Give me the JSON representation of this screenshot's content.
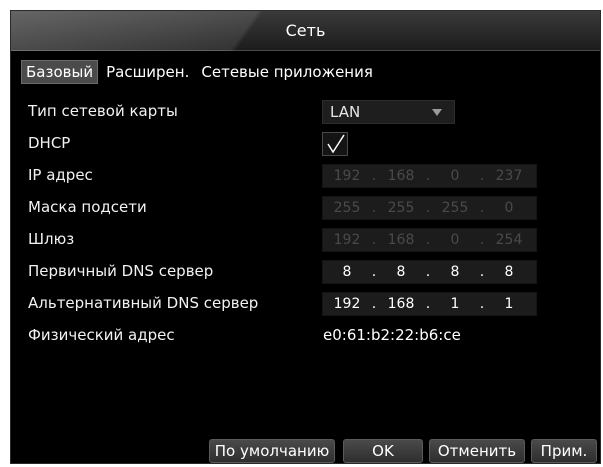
{
  "window": {
    "title": "Сеть"
  },
  "tabs": [
    {
      "label": "Базовый",
      "active": true
    },
    {
      "label": "Расширен.",
      "active": false
    },
    {
      "label": "Сетевые приложения",
      "active": false
    }
  ],
  "fields": {
    "nic_type": {
      "label": "Тип сетевой карты",
      "value": "LAN"
    },
    "dhcp": {
      "label": "DHCP",
      "checked": true
    },
    "ip": {
      "label": "IP адрес",
      "octets": [
        "192",
        "168",
        "0",
        "237"
      ],
      "enabled": false
    },
    "mask": {
      "label": "Маска подсети",
      "octets": [
        "255",
        "255",
        "255",
        "0"
      ],
      "enabled": false
    },
    "gateway": {
      "label": "Шлюз",
      "octets": [
        "192",
        "168",
        "0",
        "254"
      ],
      "enabled": false
    },
    "dns1": {
      "label": "Первичный DNS сервер",
      "octets": [
        "8",
        "8",
        "8",
        "8"
      ],
      "enabled": true
    },
    "dns2": {
      "label": "Альтернативный DNS сервер",
      "octets": [
        "192",
        "168",
        "1",
        "1"
      ],
      "enabled": true
    },
    "mac": {
      "label": "Физический адрес",
      "value": "e0:61:b2:22:b6:ce"
    }
  },
  "buttons": {
    "default": "По умолчанию",
    "ok": "OK",
    "cancel": "Отменить",
    "apply": "Прим."
  },
  "colors": {
    "background": "#000000",
    "tab_active_bg": "#4b4b4b",
    "disabled_text": "#4a4a4a",
    "enabled_text": "#ffffff"
  },
  "icons": {
    "dhcp_check": "checkmark-icon",
    "nic_dropdown": "triangle-down-icon"
  }
}
